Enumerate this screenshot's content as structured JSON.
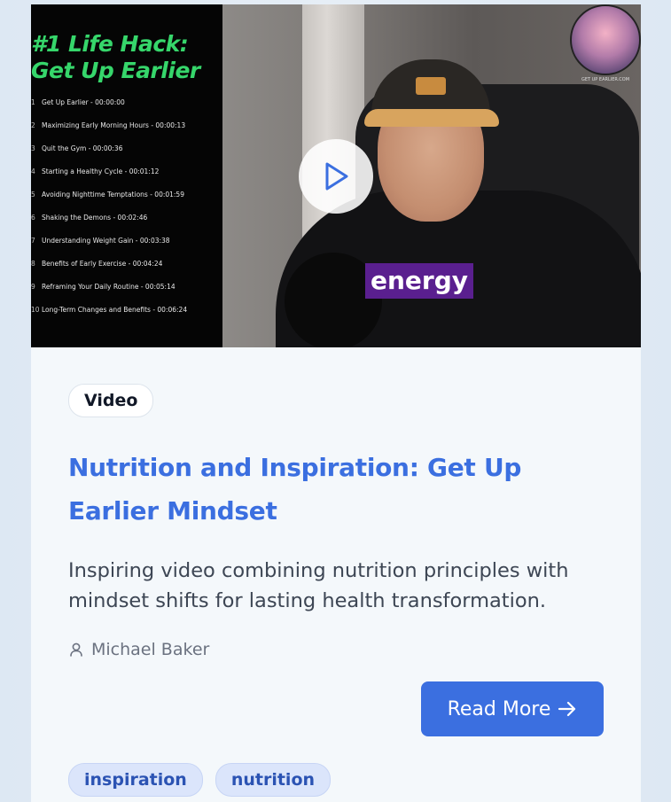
{
  "thumbnail": {
    "heading_line1": "#1 Life Hack:",
    "heading_line2": "Get Up Earlier",
    "chapters": [
      {
        "num": "1",
        "text": "Get Up Earlier - 00:00:00"
      },
      {
        "num": "2",
        "text": "Maximizing Early Morning Hours - 00:00:13"
      },
      {
        "num": "3",
        "text": "Quit the Gym - 00:00:36"
      },
      {
        "num": "4",
        "text": "Starting a Healthy Cycle - 00:01:12"
      },
      {
        "num": "5",
        "text": "Avoiding Nighttime Temptations - 00:01:59"
      },
      {
        "num": "6",
        "text": "Shaking the Demons - 00:02:46"
      },
      {
        "num": "7",
        "text": "Understanding Weight Gain - 00:03:38"
      },
      {
        "num": "8",
        "text": "Benefits of Early Exercise - 00:04:24"
      },
      {
        "num": "9",
        "text": "Reframing Your Daily Routine - 00:05:14"
      },
      {
        "num": "10",
        "text": "Long-Term Changes and Benefits - 00:06:24"
      }
    ],
    "caption_word": "energy",
    "logo_text": "GET UP EARLIER.COM",
    "play_icon": "play-icon"
  },
  "card": {
    "type_label": "Video",
    "title": "Nutrition and Inspiration: Get Up Earlier Mindset",
    "description": "Inspiring video combining nutrition principles with mindset shifts for lasting health transformation.",
    "author": "Michael Baker",
    "author_icon": "user-icon",
    "read_more_label": "Read More",
    "read_more_icon": "arrow-right-icon",
    "tags": [
      "inspiration",
      "nutrition"
    ]
  },
  "colors": {
    "accent": "#3b6fe0",
    "tag_bg": "#dbe5fb",
    "card_bg": "#f4f8fb",
    "page_bg": "#dde8f3"
  }
}
